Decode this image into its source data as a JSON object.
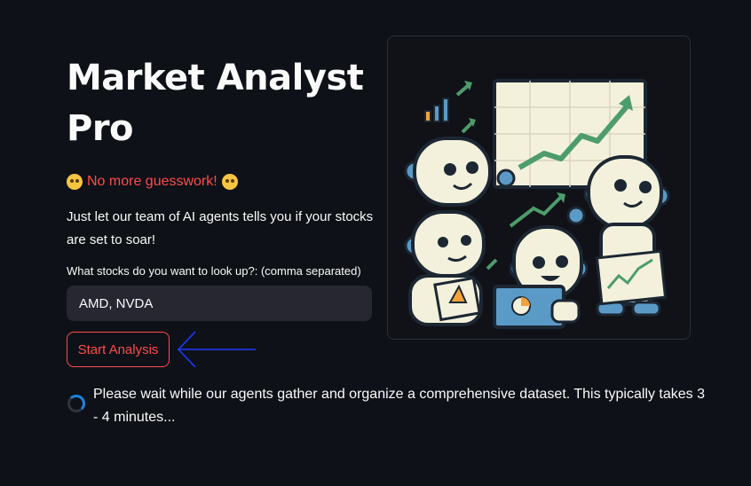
{
  "header": {
    "title_line1": "Market Analyst",
    "title_line2": "Pro",
    "subtitle": "No more guesswork!"
  },
  "description": "Just let our team of AI agents tells you if your stocks are set to soar!",
  "form": {
    "label": "What stocks do you want to look up?: (comma separated)",
    "input_value": "AMD, NVDA",
    "button_label": "Start Analysis"
  },
  "status": {
    "message": "Please wait while our agents gather and organize a comprehensive dataset. This typically takes 3 - 4 minutes..."
  },
  "colors": {
    "background": "#0e1117",
    "accent": "#ff4b4b",
    "input_bg": "#262730",
    "spinner": "#1c83e1",
    "annotation_arrow": "#1a3cff"
  },
  "icons": [
    "nerd-face-emoji-icon",
    "astonished-face-emoji-icon",
    "loading-spinner-icon",
    "annotation-arrow-icon"
  ]
}
